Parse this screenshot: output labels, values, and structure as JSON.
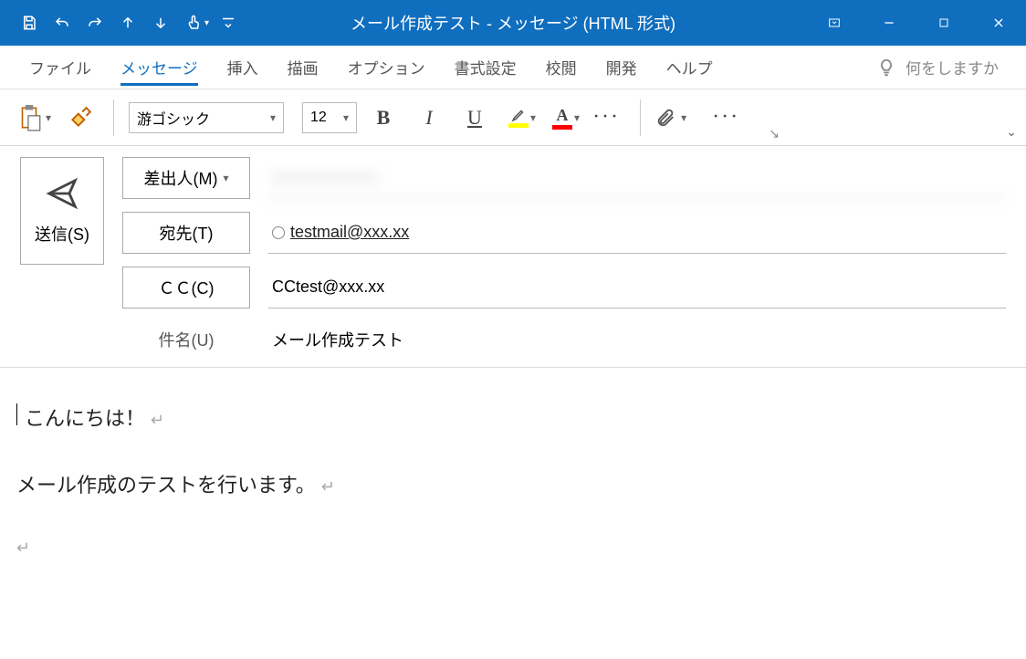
{
  "titlebar": {
    "title": "メール作成テスト  -  メッセージ (HTML 形式)"
  },
  "ribbon": {
    "tabs": [
      "ファイル",
      "メッセージ",
      "挿入",
      "描画",
      "オプション",
      "書式設定",
      "校閲",
      "開発",
      "ヘルプ"
    ],
    "active_index": 1,
    "tell_me": "何をしますか"
  },
  "toolbar": {
    "font_name": "游ゴシック",
    "font_size": "12",
    "highlight_color": "#ffff00",
    "font_color": "#ff0000"
  },
  "header": {
    "send_label": "送信(S)",
    "from_label": "差出人(M)",
    "from_value": "xxxxxxxxxxxxx",
    "to_label": "宛先(T)",
    "to_value": "testmail@xxx.xx",
    "cc_label": "ＣＣ(C)",
    "cc_value": "CCtest@xxx.xx",
    "subject_label": "件名(U)",
    "subject_value": "メール作成テスト"
  },
  "body": {
    "line1": "こんにちは！",
    "line2": "メール作成のテストを行います。"
  }
}
